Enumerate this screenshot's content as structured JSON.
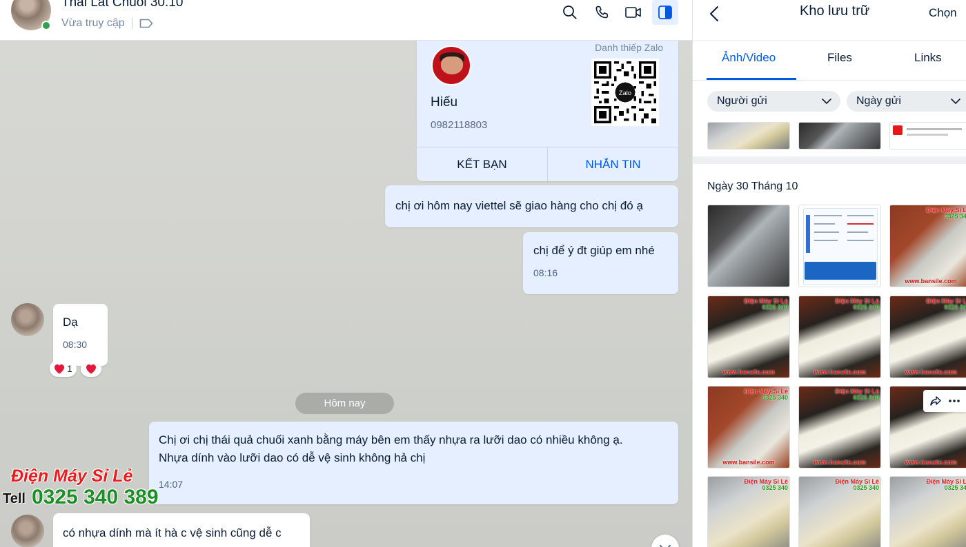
{
  "header": {
    "title": "Thái Lát Chuối 30.10",
    "status": "Vừa truy cập"
  },
  "contact_card": {
    "label": "Danh thiếp Zalo",
    "name": "Hiếu",
    "phone": "0982118803",
    "qr_brand": "Zalo",
    "add_friend": "KẾT BẠN",
    "message": "NHẮN TIN"
  },
  "messages": [
    {
      "id": "m1",
      "direction": "out",
      "text": "chị ơi hôm nay viettel sẽ giao hàng cho chị đó ạ"
    },
    {
      "id": "m2",
      "direction": "out",
      "text": "chị để ý đt giúp em nhé",
      "time": "08:16"
    },
    {
      "id": "m3",
      "direction": "in",
      "text": "Dạ",
      "time": "08:30",
      "reaction_count": "1"
    },
    {
      "id": "m4",
      "direction": "out",
      "text_line1": "Chị ơi chị thái quả chuối xanh bằng máy bên em thấy nhựa ra lưỡi dao có nhiều không ạ.",
      "text_line2": "Nhựa dính vào lưỡi dao có dễ vệ sinh không hả chị",
      "time": "14:07"
    },
    {
      "id": "m5",
      "direction": "in",
      "text": "có nhựa dính mà ít hà c vệ sinh cũng dễ c"
    }
  ],
  "day_divider": "Hôm nay",
  "watermark": {
    "name": "Điện Máy Sỉ Lẻ",
    "tel_label": "Tell",
    "phone": "0325 340 389"
  },
  "panel": {
    "title": "Kho lưu trữ",
    "choose": "Chọn",
    "tabs": [
      "Ảnh/Video",
      "Files",
      "Links"
    ],
    "active_tab": "Ảnh/Video",
    "filters": {
      "sender": "Người gửi",
      "date": "Ngày gửi"
    },
    "date_group": "Ngày 30 Tháng 10",
    "overlay": {
      "shop": "Điện Máy Sỉ Lẻ",
      "phone": "0325 340",
      "site": "www.bansile.com"
    }
  },
  "colors": {
    "accent": "#005ae0",
    "out_bubble": "#e5efff",
    "online": "#30a24b",
    "brand_red": "#e81c1c",
    "brand_green": "#1b8f24"
  },
  "icons": [
    "search-icon",
    "phone-icon",
    "video-icon",
    "sidebar-toggle-icon",
    "tag-icon",
    "back-icon",
    "chevron-down-icon",
    "share-icon",
    "more-icon",
    "heart-icon"
  ]
}
